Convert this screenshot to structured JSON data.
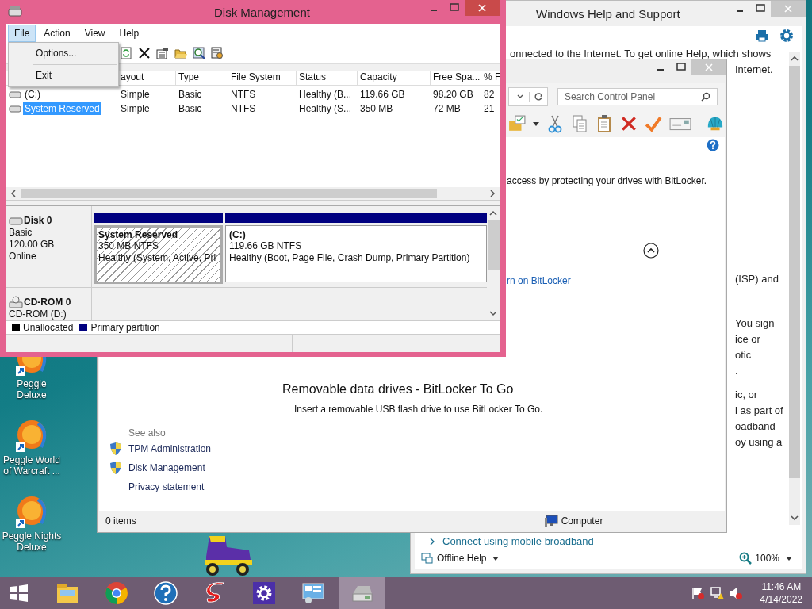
{
  "desktop": {
    "icons": [
      {
        "label": "Peggle Deluxe"
      },
      {
        "label": "Peggle World of Warcraft ..."
      },
      {
        "label": "Peggle Nights Deluxe"
      }
    ]
  },
  "help_window": {
    "title": "Windows Help and Support",
    "text_lines": [
      "onnected to the Internet. To get online Help, which shows",
      "Internet.",
      "(ISP) and",
      "You sign",
      "ice or",
      "otic",
      ".",
      "ic, or",
      "l as part of",
      "oadband",
      "oy using a"
    ],
    "link": "Connect using mobile broadband",
    "offline": "Offline Help",
    "zoom": "100%"
  },
  "control_panel": {
    "search": {
      "placeholder": "Search Control Panel"
    },
    "intro": "access by protecting your drives with BitLocker.",
    "link": "rn on BitLocker",
    "heading": "Removable data drives - BitLocker To Go",
    "note": "Insert a removable USB flash drive to use BitLocker To Go.",
    "see_also": {
      "title": "See also",
      "links": [
        {
          "label": "TPM Administration",
          "shield": true
        },
        {
          "label": "Disk Management",
          "shield": true
        },
        {
          "label": "Privacy statement",
          "shield": false
        }
      ]
    },
    "status_bar": {
      "items": "0 items",
      "location": "Computer"
    }
  },
  "disk_management": {
    "title": "Disk Management",
    "menu": [
      {
        "label": "File",
        "selected": true
      },
      {
        "label": "Action",
        "selected": false
      },
      {
        "label": "View",
        "selected": false
      },
      {
        "label": "Help",
        "selected": false
      }
    ],
    "file_menu": [
      "Options...",
      "Exit"
    ],
    "table": {
      "columns": [
        "ayout",
        "Type",
        "File System",
        "Status",
        "Capacity",
        "Free Spa...",
        "% F"
      ],
      "rows": [
        {
          "volume": "(C:)",
          "cells": [
            "Simple",
            "Basic",
            "NTFS",
            "Healthy (B...",
            "119.66 GB",
            "98.20 GB",
            "82"
          ],
          "selected": false
        },
        {
          "volume": "System Reserved",
          "cells": [
            "Simple",
            "Basic",
            "NTFS",
            "Healthy (S...",
            "350 MB",
            "72 MB",
            "21"
          ],
          "selected": true
        }
      ]
    },
    "disks": [
      {
        "kind": "disk",
        "name": "Disk 0",
        "lines": [
          "Basic",
          "120.00 GB",
          "Online"
        ],
        "partitions": [
          {
            "name": "System Reserved",
            "size": "350 MB NTFS",
            "status": "Healthy (System, Active, Pri",
            "selected": true
          },
          {
            "name": "(C:)",
            "size": "119.66 GB NTFS",
            "status": "Healthy (Boot, Page File, Crash Dump, Primary Partition)",
            "selected": false
          }
        ]
      },
      {
        "kind": "cdrom",
        "name": "CD-ROM 0",
        "lines": [
          "CD-ROM (D:)"
        ]
      }
    ],
    "legend": [
      {
        "label": "Unallocated",
        "color": "#000000"
      },
      {
        "label": "Primary partition",
        "color": "#000080"
      }
    ]
  },
  "taskbar": {
    "apps": [
      {
        "kind": "explorer",
        "selected": false
      },
      {
        "kind": "chrome",
        "selected": false
      },
      {
        "kind": "help",
        "selected": false
      },
      {
        "kind": "game",
        "selected": false
      },
      {
        "kind": "settings",
        "selected": false
      },
      {
        "kind": "panel",
        "selected": false
      },
      {
        "kind": "disk",
        "selected": true
      }
    ],
    "clock": {
      "time": "11:46 AM",
      "date": "4/14/2022"
    }
  }
}
